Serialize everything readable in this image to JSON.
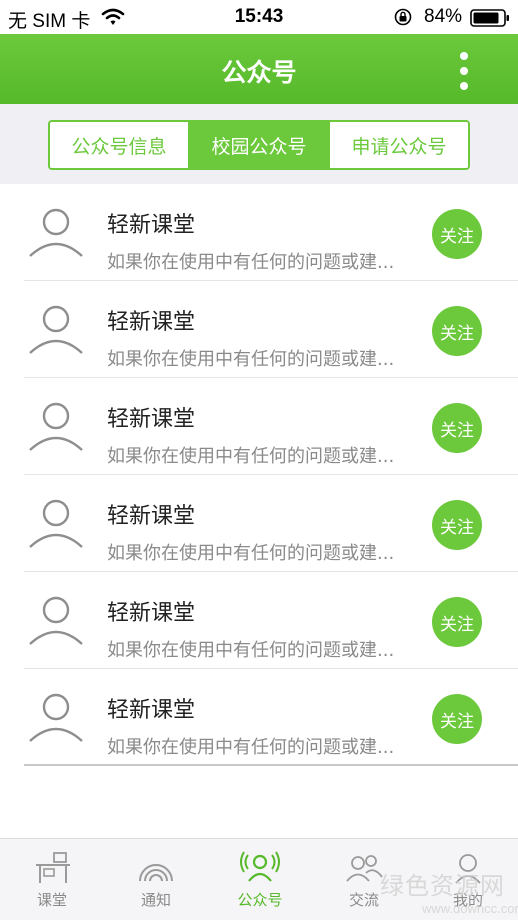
{
  "status_bar": {
    "carrier": "无 SIM 卡",
    "time": "15:43",
    "battery_percent": "84%",
    "wifi_icon": "wifi-icon",
    "lock_icon": "rotation-lock-icon",
    "battery_icon": "battery-icon"
  },
  "header": {
    "title": "公众号",
    "more_icon": "more-vertical-icon"
  },
  "segment_tabs": [
    {
      "label": "公众号信息",
      "active": false
    },
    {
      "label": "校园公众号",
      "active": true
    },
    {
      "label": "申请公众号",
      "active": false
    }
  ],
  "accounts": [
    {
      "name": "轻新课堂",
      "description": "如果你在使用中有任何的问题或建...",
      "action": "关注"
    },
    {
      "name": "轻新课堂",
      "description": "如果你在使用中有任何的问题或建...",
      "action": "关注"
    },
    {
      "name": "轻新课堂",
      "description": "如果你在使用中有任何的问题或建...",
      "action": "关注"
    },
    {
      "name": "轻新课堂",
      "description": "如果你在使用中有任何的问题或建...",
      "action": "关注"
    },
    {
      "name": "轻新课堂",
      "description": "如果你在使用中有任何的问题或建...",
      "action": "关注"
    },
    {
      "name": "轻新课堂",
      "description": "如果你在使用中有任何的问题或建...",
      "action": "关注"
    }
  ],
  "tab_bar": [
    {
      "label": "课堂",
      "icon": "classroom-icon",
      "active": false
    },
    {
      "label": "通知",
      "icon": "broadcast-icon",
      "active": false
    },
    {
      "label": "公众号",
      "icon": "public-account-icon",
      "active": true
    },
    {
      "label": "交流",
      "icon": "community-icon",
      "active": false
    },
    {
      "label": "我的",
      "icon": "profile-icon",
      "active": false
    }
  ],
  "watermark": {
    "main": "绿色资源网",
    "sub": "www.downcc.com"
  },
  "colors": {
    "accent": "#6cc93c",
    "accent_dark": "#55b92a",
    "background_gray": "#efeff4"
  }
}
